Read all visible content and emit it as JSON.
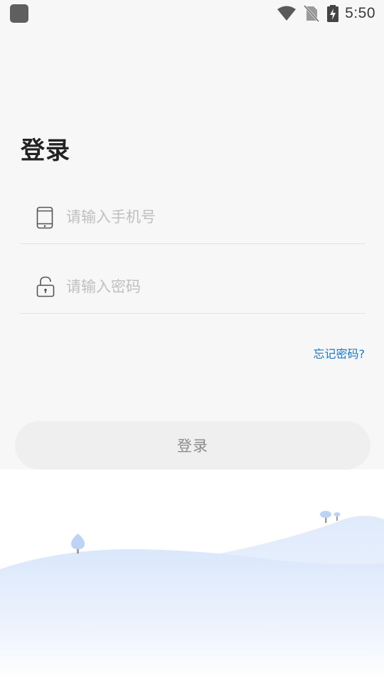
{
  "status_bar": {
    "time": "5:50",
    "icons": [
      "wifi-icon",
      "no-sim-icon",
      "battery-charging-icon"
    ]
  },
  "login": {
    "title": "登录",
    "phone_placeholder": "请输入手机号",
    "password_placeholder": "请输入密码",
    "forgot_password": "忘记密码?",
    "submit_label": "登录"
  },
  "colors": {
    "background": "#f7f7f7",
    "link": "#1677cf",
    "button_bg": "#efefef",
    "button_text": "#8c8c8c",
    "illustration": "#dbe8fb"
  }
}
